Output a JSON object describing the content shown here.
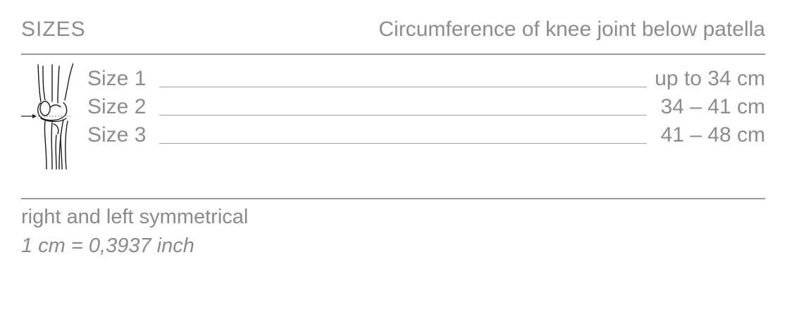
{
  "header": {
    "title": "SIZES",
    "measurement_label": "Circumference of knee joint below patella"
  },
  "illustration": {
    "icon": "knee-anatomy-icon"
  },
  "sizes": [
    {
      "label": "Size 1",
      "value": "up to 34 cm"
    },
    {
      "label": "Size 2",
      "value": "34 – 41 cm"
    },
    {
      "label": "Size 3",
      "value": "41 – 48 cm"
    }
  ],
  "notes": {
    "symmetry": "right and left symmetrical",
    "conversion": "1 cm = 0,3937 inch"
  },
  "colors": {
    "text": "#8c8c8c",
    "rule": "#9a9a9a"
  }
}
